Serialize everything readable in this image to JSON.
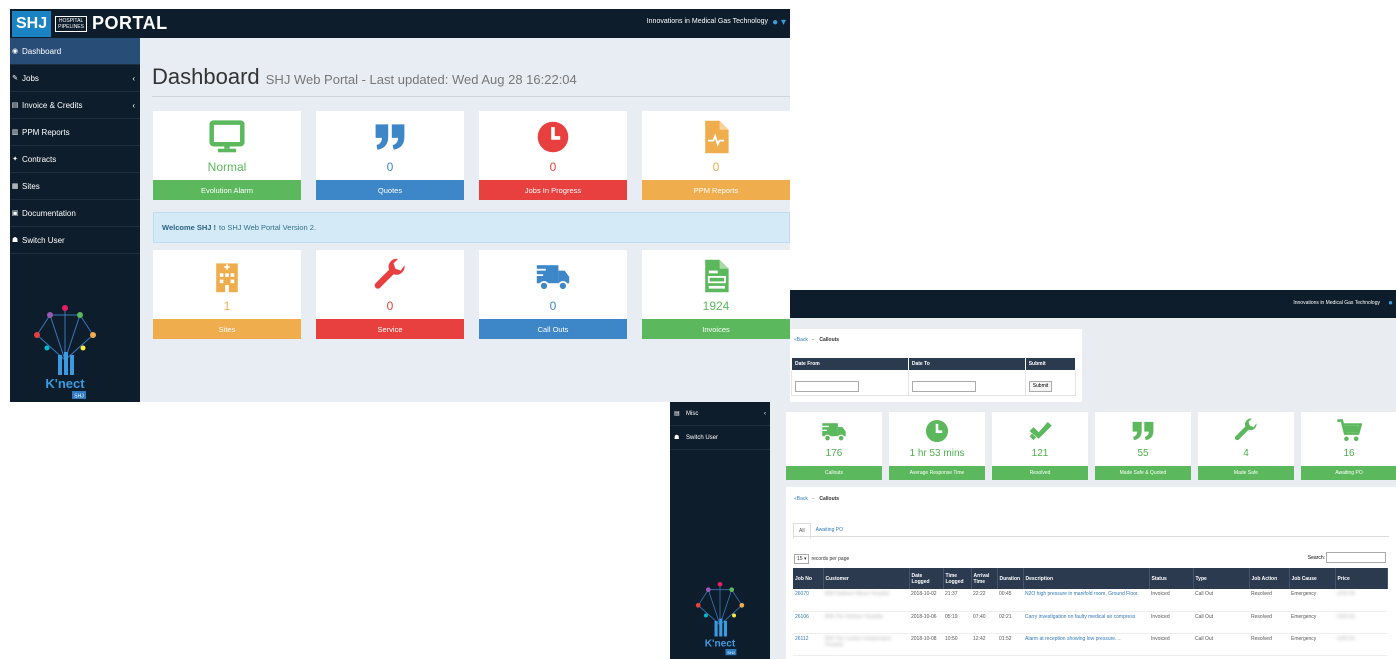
{
  "front": {
    "logo": {
      "shj": "SHJ",
      "hp_line1": "HOSPITAL",
      "hp_line2": "PIPELINES",
      "portal": "PORTAL"
    },
    "tagline": "Innovations in Medical Gas Technology",
    "sidebar": [
      {
        "label": "Dashboard",
        "icon": "dashboard-icon",
        "active": true
      },
      {
        "label": "Jobs",
        "icon": "wrench-icon",
        "arrow": "‹"
      },
      {
        "label": "Invoice & Credits",
        "icon": "file-icon",
        "arrow": "‹"
      },
      {
        "label": "PPM Reports",
        "icon": "chart-icon"
      },
      {
        "label": "Contracts",
        "icon": "handshake-icon"
      },
      {
        "label": "Sites",
        "icon": "building-icon"
      },
      {
        "label": "Documentation",
        "icon": "book-icon"
      },
      {
        "label": "Switch User",
        "icon": "users-icon"
      }
    ],
    "knect_label": "K'nect",
    "knect_sub": "SHJ",
    "title": "Dashboard",
    "subtitle": "SHJ Web Portal - Last updated: Wed Aug 28 16:22:04",
    "tiles_top": [
      {
        "value": "Normal",
        "label": "Evolution Alarm",
        "icon": "monitor-icon",
        "color": "#5cb85c"
      },
      {
        "value": "0",
        "label": "Quotes",
        "icon": "quote-icon",
        "color": "#3d87c9"
      },
      {
        "value": "0",
        "label": "Jobs In Progress",
        "icon": "clock-icon",
        "color": "#e8403f"
      },
      {
        "value": "0",
        "label": "PPM Reports",
        "icon": "pulse-file-icon",
        "color": "#f0ad4e"
      }
    ],
    "welcome_bold": "Welcome SHJ !",
    "welcome_text": "to SHJ Web Portal Version 2.",
    "tiles_bottom": [
      {
        "value": "1",
        "label": "Sites",
        "icon": "hospital-icon",
        "color": "#f0ad4e"
      },
      {
        "value": "0",
        "label": "Service",
        "icon": "wrench-icon",
        "color": "#e8403f"
      },
      {
        "value": "0",
        "label": "Call Outs",
        "icon": "truck-icon",
        "color": "#3d87c9"
      },
      {
        "value": "1924",
        "label": "Invoices",
        "icon": "invoice-icon",
        "color": "#5cb85c"
      }
    ]
  },
  "back": {
    "tagline": "Innovations in Medical Gas Technology",
    "sidebar": [
      {
        "label": "Misc",
        "icon": "book-icon",
        "arrow": "‹"
      },
      {
        "label": "Switch User",
        "icon": "users-icon"
      }
    ],
    "knect_label": "K'nect",
    "knect_sub": "SHJ",
    "crumb_back": "«Back",
    "crumb_sep": "-",
    "crumb_page": "Callouts",
    "filters": {
      "date_from": "Date From",
      "date_to": "Date To",
      "submit_header": "Submit",
      "submit_button": "Submit"
    },
    "stats": [
      {
        "value": "176",
        "label": "Callouts",
        "icon": "truck-icon"
      },
      {
        "value": "1 hr 53 mins",
        "label": "Average Response Time",
        "icon": "clock-icon"
      },
      {
        "value": "121",
        "label": "Resolved",
        "icon": "check-icon"
      },
      {
        "value": "55",
        "label": "Made Safe & Quoted",
        "icon": "quote-icon"
      },
      {
        "value": "4",
        "label": "Made Safe",
        "icon": "wrench-icon"
      },
      {
        "value": "16",
        "label": "Awaiting PO",
        "icon": "cart-icon"
      }
    ],
    "tabs": [
      "All",
      "Awaiting PO"
    ],
    "per_page_value": "15",
    "per_page_label": "records per page",
    "search_label": "Search:",
    "columns": [
      "Job No",
      "Customer",
      "Date Logged",
      "Time Logged",
      "Arrival Time",
      "Duration",
      "Description",
      "Status",
      "Type",
      "Job Action",
      "Job Cause",
      "Price"
    ],
    "rows": [
      [
        "26070",
        "BMI Hadham Manor Hospital",
        "2018-10-02",
        "21:37",
        "22:22",
        "00:45",
        "N2O high pressure in manifold room, Ground Floor.",
        "Invoiced",
        "Call Out",
        "Resolved",
        "Emergency",
        "£350.00"
      ],
      [
        "26106",
        "BMI The Harbour Hospital",
        "2018-10-06",
        "05:19",
        "07:40",
        "02:21",
        "Carry investigation on faulty medical air compress",
        "Invoiced",
        "Call Out",
        "Resolved",
        "Emergency",
        "£350.00"
      ],
      [
        "26112",
        "BMI The London Independent Hospital",
        "2018-10-08",
        "10:50",
        "12:42",
        "01:52",
        "Alarm at reception showing low pressure. ..",
        "Invoiced",
        "Call Out",
        "Resolved",
        "Emergency",
        "£350.00"
      ]
    ]
  }
}
